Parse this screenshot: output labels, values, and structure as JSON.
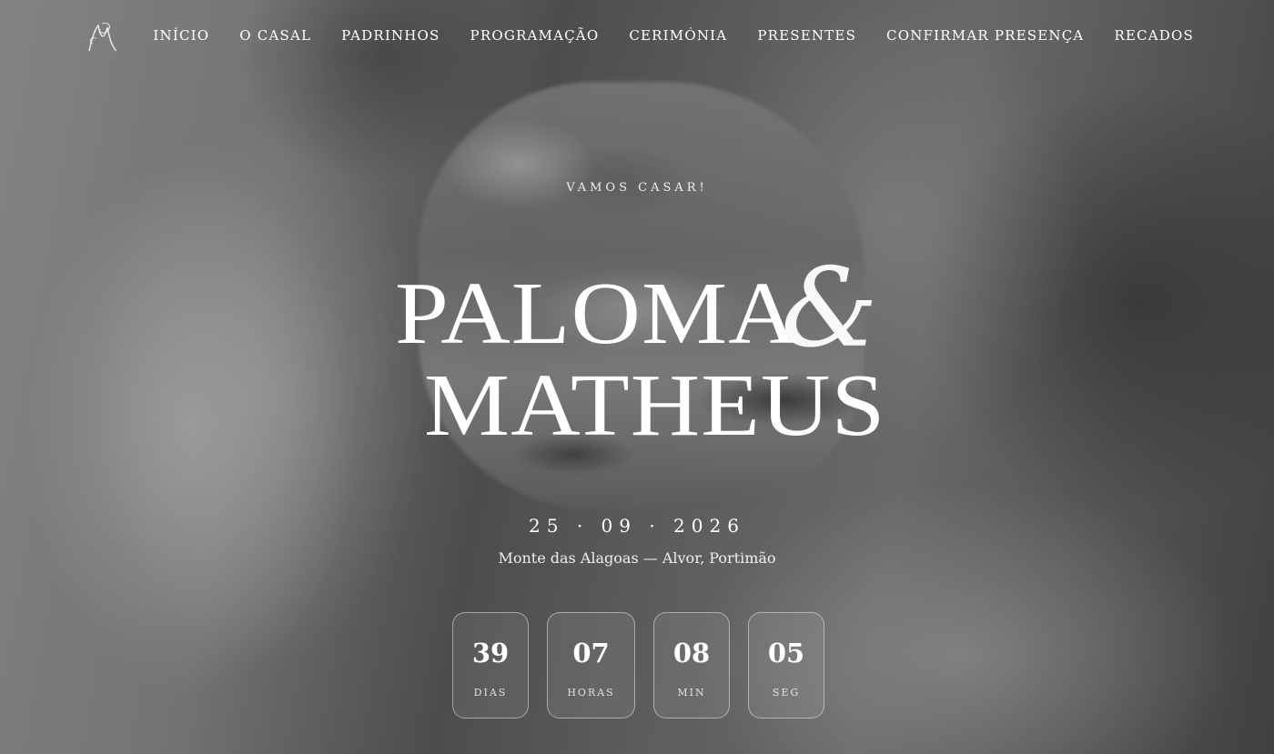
{
  "nav": {
    "logo_icon": "monogram-pm-logo",
    "items": [
      {
        "label": "INÍCIO"
      },
      {
        "label": "O CASAL"
      },
      {
        "label": "PADRINHOS"
      },
      {
        "label": "PROGRAMAÇÃO"
      },
      {
        "label": "CERIMÓNIA"
      },
      {
        "label": "PRESENTES"
      },
      {
        "label": "CONFIRMAR PRESENÇA"
      },
      {
        "label": "RECADOS"
      }
    ]
  },
  "hero": {
    "eyebrow": "VAMOS CASAR!",
    "name_1": "PALOMA",
    "ampersand": "&",
    "name_2": "MATHEUS",
    "date": "25 · 09 · 2026",
    "location": "Monte das Alagoas — Alvor, Portimão"
  },
  "countdown": {
    "days": {
      "value": "39",
      "label": "DIAS"
    },
    "hours": {
      "value": "07",
      "label": "HORAS"
    },
    "minutes": {
      "value": "08",
      "label": "MIN"
    },
    "seconds": {
      "value": "05",
      "label": "SEG"
    }
  },
  "colors": {
    "text": "#ffffff",
    "background_tone": "#6f6f6f"
  }
}
